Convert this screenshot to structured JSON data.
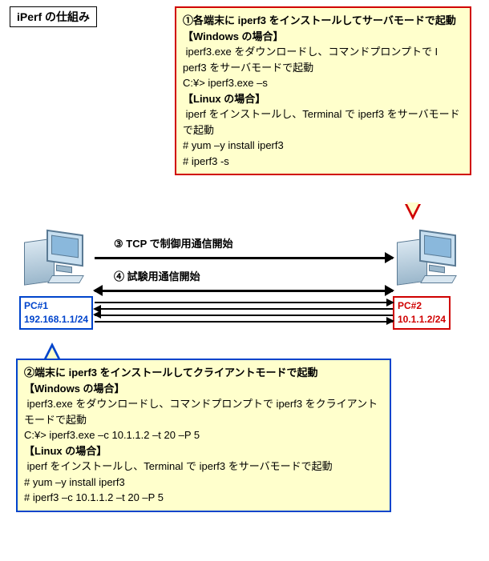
{
  "title": "iPerf の仕組み",
  "callout_top": {
    "heading": "①各端末に iperf3 をインストールしてサーバモードで起動",
    "win_head": "【Windows の場合】",
    "win_text": " iperf3.exe をダウンロードし、コマンドプロンプトで I perf3 をサーバモードで起動",
    "win_cmd": "C:¥> iperf3.exe –s",
    "lin_head": "【Linux の場合】",
    "lin_text": " iperf をインストールし、Terminal で iperf3 をサーバモードで起動",
    "lin_cmd1": "# yum –y install iperf3",
    "lin_cmd2": "# iperf3 -s"
  },
  "callout_bottom": {
    "heading": "②端末に iperf3 をインストールしてクライアントモードで起動",
    "win_head": "【Windows の場合】",
    "win_text": " iperf3.exe をダウンロードし、コマンドプロンプトで iperf3 をクライアントモードで起動",
    "win_cmd": "C:¥> iperf3.exe –c 10.1.1.2 –t 20 –P 5",
    "lin_head": "【Linux の場合】",
    "lin_text": " iperf をインストールし、Terminal で iperf3 をサーバモードで起動",
    "lin_cmd1": "# yum –y install iperf3",
    "lin_cmd2": "# iperf3 –c 10.1.1.2 –t 20 –P 5"
  },
  "net": {
    "step3": "③ TCP で制御用通信開始",
    "step4": "④ 試験用通信開始"
  },
  "pc1": {
    "name": "PC#1",
    "ip": "192.168.1.1/24"
  },
  "pc2": {
    "name": "PC#2",
    "ip": "10.1.1.2/24"
  }
}
